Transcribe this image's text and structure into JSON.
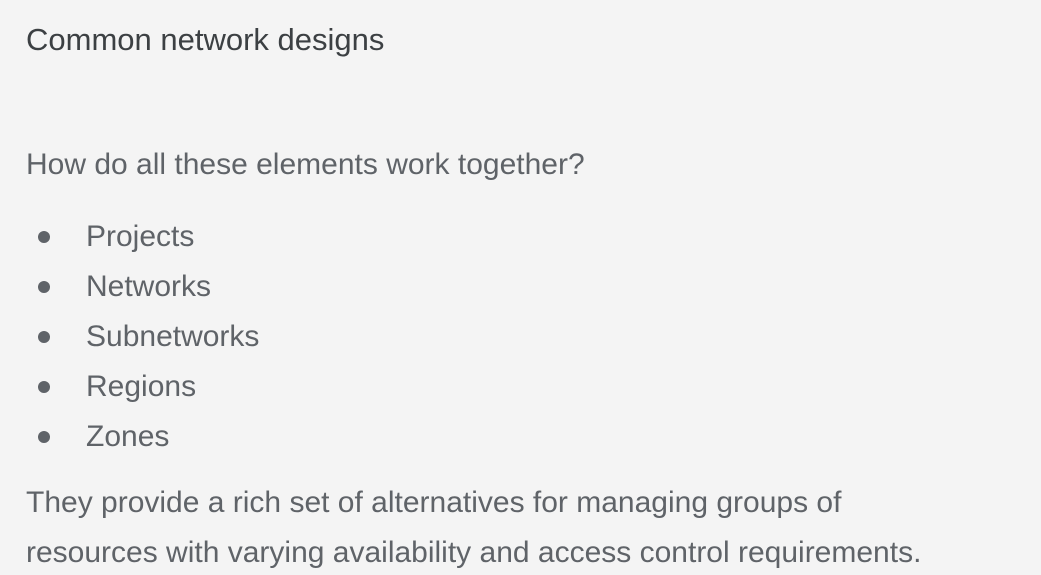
{
  "slide": {
    "title": "Common network designs",
    "question": "How do all these elements work together?",
    "bullets": [
      {
        "label": "Projects"
      },
      {
        "label": "Networks"
      },
      {
        "label": "Subnetworks"
      },
      {
        "label": "Regions"
      },
      {
        "label": "Zones"
      }
    ],
    "summary_lines": [
      "They provide a rich set of alternatives for managing groups of",
      "resources with varying availability and access control requirements."
    ]
  }
}
